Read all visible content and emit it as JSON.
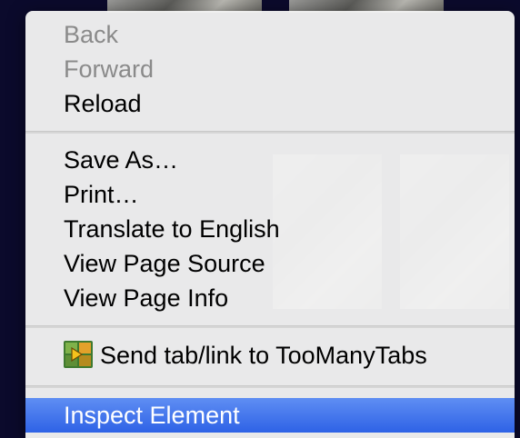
{
  "menu": {
    "items": [
      {
        "label": "Back",
        "enabled": false
      },
      {
        "label": "Forward",
        "enabled": false
      },
      {
        "label": "Reload",
        "enabled": true
      },
      {
        "label": "Save As…",
        "enabled": true
      },
      {
        "label": "Print…",
        "enabled": true
      },
      {
        "label": "Translate to English",
        "enabled": true
      },
      {
        "label": "View Page Source",
        "enabled": true
      },
      {
        "label": "View Page Info",
        "enabled": true
      },
      {
        "label": "Send tab/link to TooManyTabs",
        "enabled": true,
        "icon": "toomanytabs-icon"
      },
      {
        "label": "Inspect Element",
        "enabled": true,
        "highlighted": true
      }
    ]
  },
  "colors": {
    "highlight": "#3a6ee8",
    "disabled_text": "#8a8a8a",
    "menu_background": "#f2f2f2",
    "desktop_background": "#0b0a2c"
  }
}
